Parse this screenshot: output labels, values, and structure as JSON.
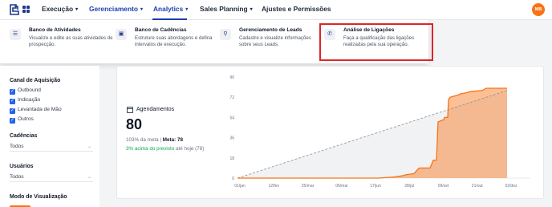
{
  "app": {
    "logo_icon": "app-logo-icon",
    "apps_icon": "apps-grid-icon"
  },
  "nav": {
    "items": [
      {
        "label": "Execução",
        "has_chevron": true
      },
      {
        "label": "Gerenciamento",
        "has_chevron": true
      },
      {
        "label": "Analytics",
        "has_chevron": true
      },
      {
        "label": "Sales Planning",
        "has_chevron": true
      },
      {
        "label": "Ajustes e Permissões",
        "has_chevron": false
      }
    ],
    "active": "Analytics",
    "chevron": "▾"
  },
  "user": {
    "initials": "MB",
    "color": "#f97316"
  },
  "dropdown": {
    "items": [
      {
        "title": "Banco de Atividades",
        "desc": "Visualize e edite as suas atividades de prospecção.",
        "icon": "task-list-icon",
        "glyph": "☰"
      },
      {
        "title": "Banco de Cadências",
        "desc": "Estruture suas abordagens e defina intervalos de execução.",
        "icon": "cadence-icon",
        "glyph": "▣"
      },
      {
        "title": "Gerenciamento de Leads",
        "desc": "Cadastre e visualize informações sobre seus Leads.",
        "icon": "pin-icon",
        "glyph": "⚲"
      },
      {
        "title": "Análise de Ligações",
        "desc": "Faça a qualificação das ligações realizadas pela sua operação.",
        "icon": "phone-icon",
        "glyph": "✆"
      }
    ],
    "highlight_color": "#dc2626"
  },
  "sidebar": {
    "canal": {
      "title": "Canal de Aquisição",
      "options": [
        {
          "label": "Outbound",
          "checked": true
        },
        {
          "label": "Indicação",
          "checked": true
        },
        {
          "label": "Levantada de Mão",
          "checked": true
        },
        {
          "label": "Outros",
          "checked": true
        }
      ]
    },
    "cadencias": {
      "title": "Cadências",
      "value": "Todos"
    },
    "usuarios": {
      "title": "Usuários",
      "value": "Todos"
    },
    "modo": {
      "title": "Modo de Visualização"
    },
    "select_chevron": "⌄",
    "check_glyph": "✓"
  },
  "kpi": {
    "label": "Agendamentos",
    "value": "80",
    "pct": "103% da meta",
    "sep": " | ",
    "meta_label": "Meta: 78",
    "prev_green": "3% acima do previsto",
    "prev_rest": " até hoje (78)"
  },
  "chart_data": {
    "type": "line",
    "x_ticks": [
      "01/jan",
      "12/fev",
      "25/mar",
      "06/mai",
      "17/jun",
      "28/jul",
      "09/set",
      "21/out",
      "02/dez"
    ],
    "y_ticks": [
      0,
      18,
      36,
      54,
      72,
      90
    ],
    "ylim": [
      0,
      90
    ],
    "x_range": [
      0,
      365
    ],
    "grid": false,
    "series": [
      {
        "style": "solid-area",
        "color": "#f97316",
        "points": [
          [
            0,
            0
          ],
          [
            70,
            0
          ],
          [
            140,
            0
          ],
          [
            175,
            0
          ],
          [
            195,
            1
          ],
          [
            205,
            2
          ],
          [
            210,
            3
          ],
          [
            220,
            4
          ],
          [
            225,
            8
          ],
          [
            227,
            9
          ],
          [
            240,
            9
          ],
          [
            244,
            16
          ],
          [
            248,
            16
          ],
          [
            250,
            50
          ],
          [
            253,
            51
          ],
          [
            257,
            52
          ],
          [
            258,
            54
          ],
          [
            262,
            54
          ],
          [
            263,
            70
          ],
          [
            265,
            72
          ],
          [
            275,
            74
          ],
          [
            278,
            75
          ],
          [
            285,
            76
          ],
          [
            290,
            77
          ],
          [
            305,
            78
          ],
          [
            310,
            80
          ],
          [
            336,
            80
          ]
        ]
      },
      {
        "style": "dashed",
        "color": "#9ca3af",
        "points": [
          [
            0,
            0
          ],
          [
            336,
            78
          ]
        ]
      }
    ]
  }
}
